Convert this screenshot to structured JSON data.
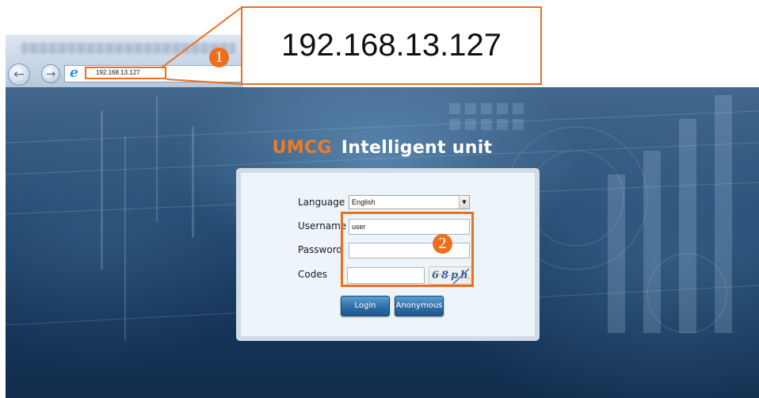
{
  "browser": {
    "address_url": "192.168.13.127",
    "back_glyph": "←",
    "forward_glyph": "→",
    "icons": [
      "back-icon",
      "forward-icon",
      "ie-logo-icon"
    ]
  },
  "callout": {
    "text": "192.168.13.127",
    "step_1": "1",
    "step_2": "2",
    "accent_color": "#ec6f1c"
  },
  "site": {
    "brand": "UMCG",
    "product": "Intelligent unit",
    "brand_color": "#f07c22"
  },
  "login": {
    "language_label": "Language",
    "language_value": "English",
    "username_label": "Username",
    "username_value": "user",
    "password_label": "Password",
    "password_value": "",
    "codes_label": "Codes",
    "codes_value": "",
    "captcha_text": "68ph",
    "login_button": "Login",
    "anonymous_button": "Anonymous"
  }
}
